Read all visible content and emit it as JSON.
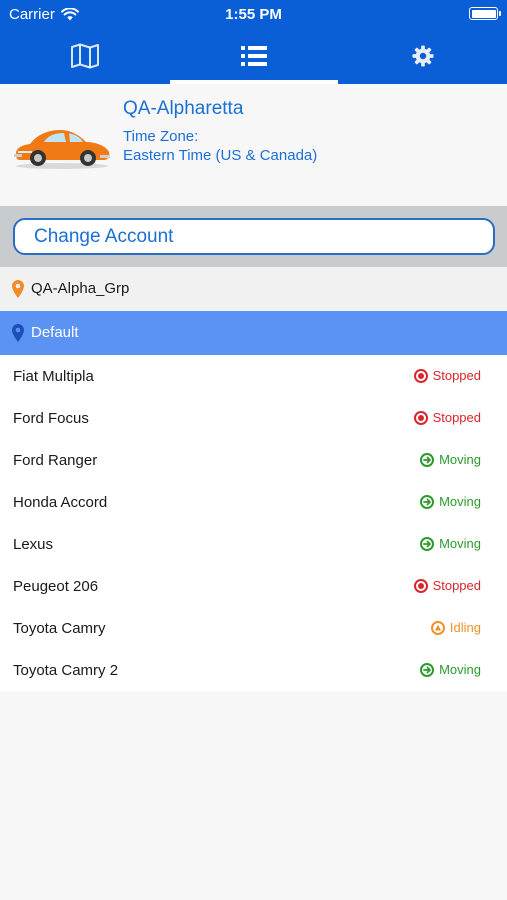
{
  "status_bar": {
    "carrier": "Carrier",
    "time": "1:55 PM"
  },
  "tabs": [
    {
      "name": "map",
      "icon": "map-icon"
    },
    {
      "name": "list",
      "icon": "list-icon",
      "selected": true
    },
    {
      "name": "settings",
      "icon": "gear-icon"
    }
  ],
  "account": {
    "name": "QA-Alpharetta",
    "timezone_label": "Time Zone:",
    "timezone_value": "Eastern Time (US & Canada)",
    "image": "car-icon"
  },
  "change_account_label": "Change Account",
  "group": {
    "label": "QA-Alpha_Grp",
    "icon": "map-pin-icon"
  },
  "default_group": {
    "label": "Default",
    "icon": "map-pin-icon",
    "selected": true
  },
  "vehicles": [
    {
      "name": "Fiat Multipla",
      "status": "Stopped"
    },
    {
      "name": "Ford Focus",
      "status": "Stopped"
    },
    {
      "name": "Ford Ranger",
      "status": "Moving"
    },
    {
      "name": "Honda Accord",
      "status": "Moving"
    },
    {
      "name": "Lexus",
      "status": "Moving"
    },
    {
      "name": "Peugeot 206",
      "status": "Stopped"
    },
    {
      "name": "Toyota Camry",
      "status": "Idling"
    },
    {
      "name": "Toyota Camry 2",
      "status": "Moving"
    }
  ],
  "colors": {
    "header": "#0a5fd6",
    "accent": "#1b6fd6",
    "selected_row": "#5b93f5",
    "stopped": "#d9262c",
    "moving": "#2c9a2c",
    "idling": "#f0902a",
    "group_pin": "#f28c28"
  }
}
